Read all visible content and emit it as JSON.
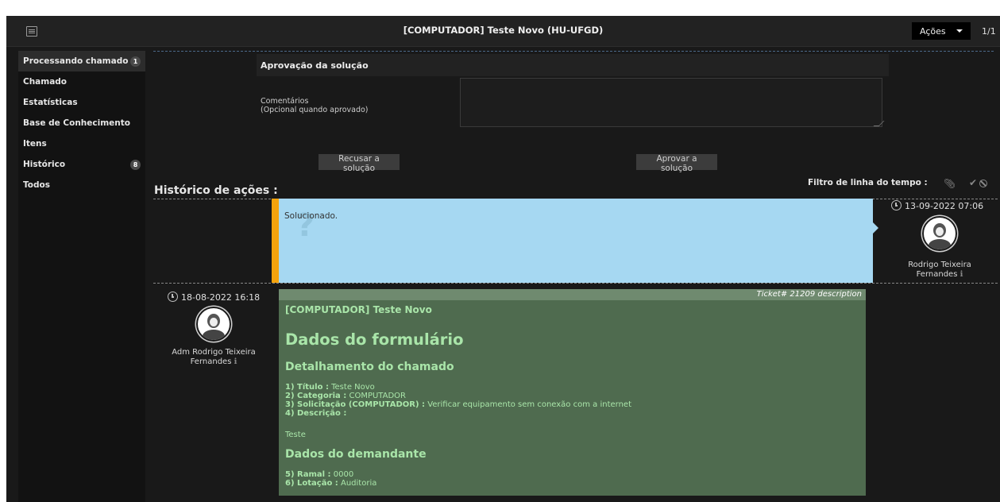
{
  "window": {
    "title": "[COMPUTADOR] Teste Novo (HU-UFGD)",
    "actions_label": "Ações",
    "page_count": "1/1"
  },
  "sidebar": {
    "items": [
      {
        "label": "Processando chamado",
        "badge": "1"
      },
      {
        "label": "Chamado"
      },
      {
        "label": "Estatísticas"
      },
      {
        "label": "Base de Conhecimento"
      },
      {
        "label": "Itens"
      },
      {
        "label": "Histórico",
        "badge": "8"
      },
      {
        "label": "Todos"
      }
    ]
  },
  "approval": {
    "heading": "Aprovação da solução",
    "comments_label": "Comentários",
    "comments_hint": "(Opcional quando aprovado)",
    "comments_value": "",
    "refuse_label": "Recusar a solução",
    "approve_label": "Aprovar a solução"
  },
  "history": {
    "title": "Histórico de ações :",
    "filter_label": "Filtro de linha do tempo :",
    "entries": [
      {
        "text": "Solucionado.",
        "date": "13-09-2022 07:06",
        "author_line1": "Rodrigo Teixeira",
        "author_line2": "Fernandes"
      },
      {
        "date": "18-08-2022 16:18",
        "author_line1": "Adm Rodrigo Teixeira",
        "author_line2": "Fernandes",
        "ticket_label": "Ticket# 21209 description",
        "title": "[COMPUTADOR] Teste Novo",
        "form_heading": "Dados do formulário",
        "section1": "Detalhamento do chamado",
        "fields": [
          {
            "label": "1) Título :",
            "value": "Teste Novo"
          },
          {
            "label": "2) Categoria :",
            "value": "COMPUTADOR"
          },
          {
            "label": "3) Solicitação (COMPUTADOR) :",
            "value": "Verificar equipamento sem conexão com a internet"
          },
          {
            "label": "4) Descrição :",
            "value": ""
          }
        ],
        "description": "Teste",
        "section2": "Dados do demandante",
        "fields2": [
          {
            "label": "5) Ramal :",
            "value": "0000"
          },
          {
            "label": "6) Lotação :",
            "value": "Auditoria"
          }
        ]
      }
    ]
  }
}
